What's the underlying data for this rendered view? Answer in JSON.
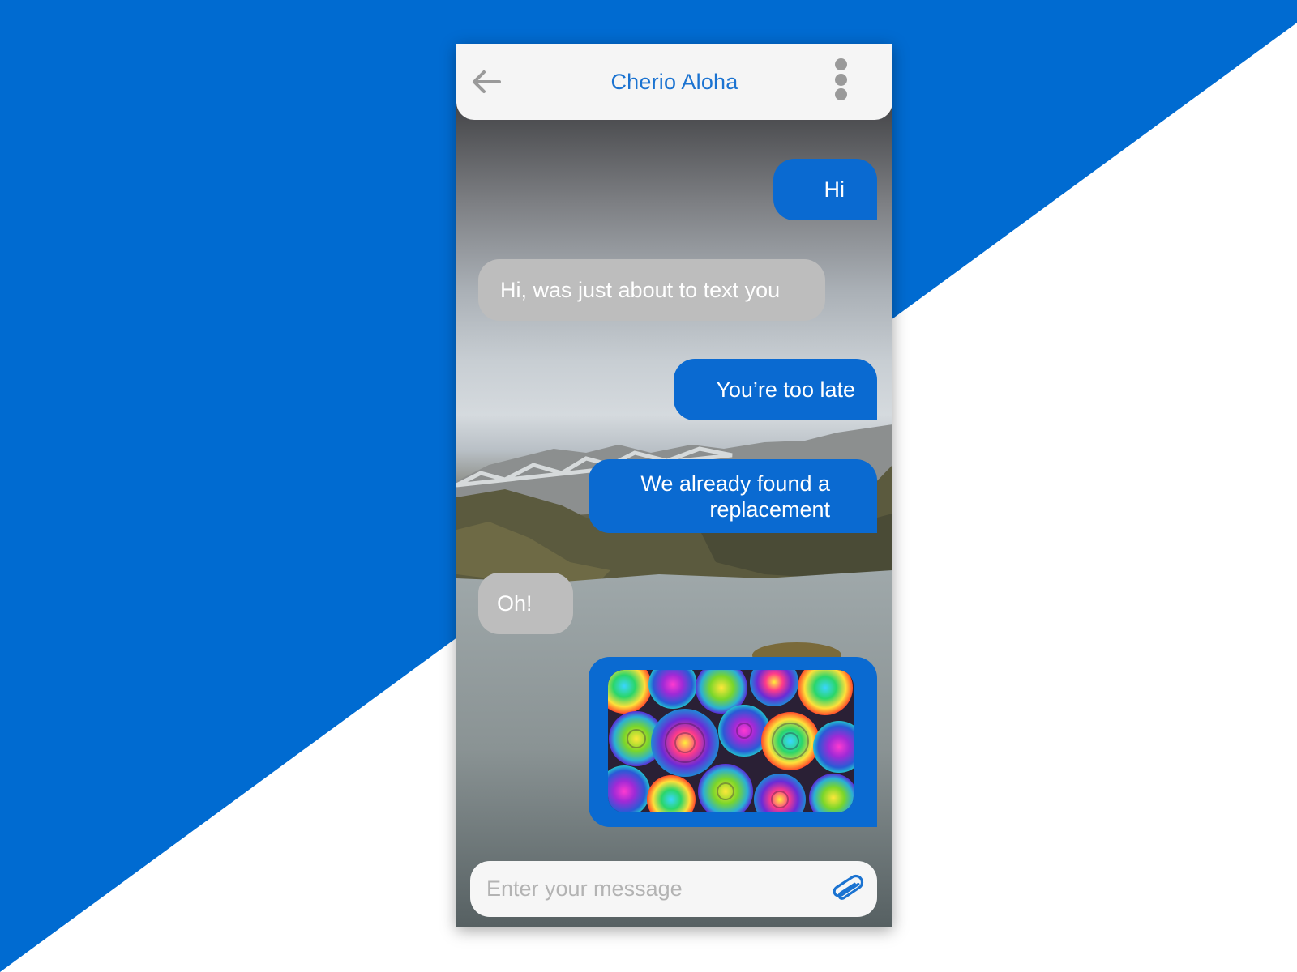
{
  "colors": {
    "accent": "#0a6ad1",
    "title": "#1b73d1",
    "received_bubble": "#bdbdbd",
    "header_bg": "#f5f5f5",
    "icon_gray": "#9a9a9a"
  },
  "header": {
    "back_icon": "arrow-left-icon",
    "title": "Cherio Aloha",
    "menu_icon": "more-vertical-icon"
  },
  "messages": [
    {
      "direction": "sent",
      "text": "Hi"
    },
    {
      "direction": "received",
      "text": "Hi, was just about to text you"
    },
    {
      "direction": "sent",
      "text": "You’re too late"
    },
    {
      "direction": "sent",
      "text": "We already found a replacement"
    },
    {
      "direction": "received",
      "text": "Oh!"
    },
    {
      "direction": "sent",
      "type": "image",
      "image": "rainbow-roses-photo"
    }
  ],
  "composer": {
    "placeholder": "Enter your message",
    "value": "",
    "attach_icon": "paperclip-icon"
  }
}
